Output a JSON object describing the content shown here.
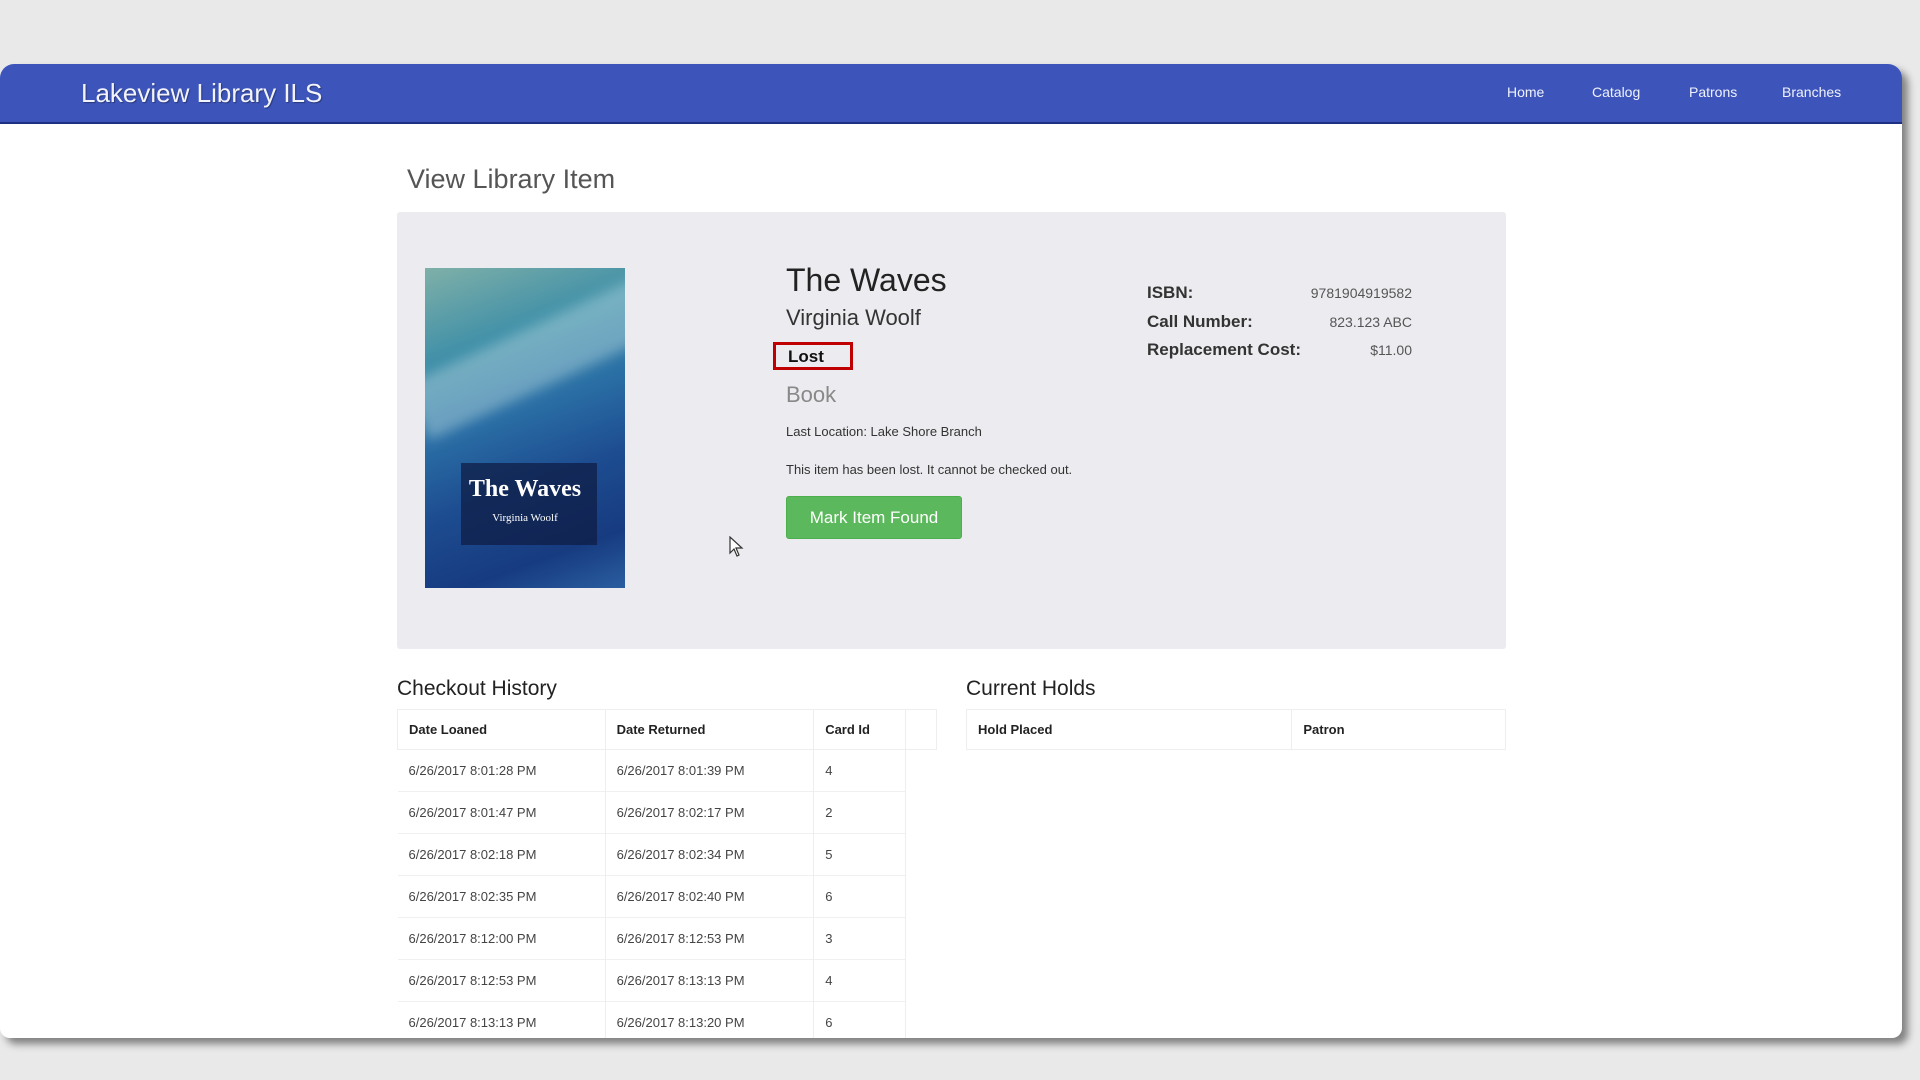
{
  "app": {
    "title": "Lakeview Library ILS",
    "nav": [
      "Home",
      "Catalog",
      "Patrons",
      "Branches"
    ]
  },
  "page": {
    "title": "View Library Item"
  },
  "item": {
    "cover_title": "The Waves",
    "cover_author": "Virginia Woolf",
    "title": "The Waves",
    "author": "Virginia Woolf",
    "status": "Lost",
    "type": "Book",
    "last_location": "Last Location: Lake Shore Branch",
    "message": "This item has been lost. It cannot be checked out.",
    "action_label": "Mark Item Found",
    "details": [
      {
        "label": "ISBN:",
        "value": "9781904919582"
      },
      {
        "label": "Call Number:",
        "value": "823.123 ABC"
      },
      {
        "label": "Replacement Cost:",
        "value": "$11.00"
      }
    ]
  },
  "checkout_history": {
    "heading": "Checkout History",
    "columns": [
      "Date Loaned",
      "Date Returned",
      "Card Id"
    ],
    "rows": [
      [
        "6/26/2017 8:01:28 PM",
        "6/26/2017 8:01:39 PM",
        "4"
      ],
      [
        "6/26/2017 8:01:47 PM",
        "6/26/2017 8:02:17 PM",
        "2"
      ],
      [
        "6/26/2017 8:02:18 PM",
        "6/26/2017 8:02:34 PM",
        "5"
      ],
      [
        "6/26/2017 8:02:35 PM",
        "6/26/2017 8:02:40 PM",
        "6"
      ],
      [
        "6/26/2017 8:12:00 PM",
        "6/26/2017 8:12:53 PM",
        "3"
      ],
      [
        "6/26/2017 8:12:53 PM",
        "6/26/2017 8:13:13 PM",
        "4"
      ],
      [
        "6/26/2017 8:13:13 PM",
        "6/26/2017 8:13:20 PM",
        "6"
      ]
    ]
  },
  "current_holds": {
    "heading": "Current Holds",
    "columns": [
      "Hold Placed",
      "Patron"
    ]
  },
  "colors": {
    "navbar": "#3d55bb",
    "button": "#5cb85c",
    "status_outline": "#c00000"
  }
}
